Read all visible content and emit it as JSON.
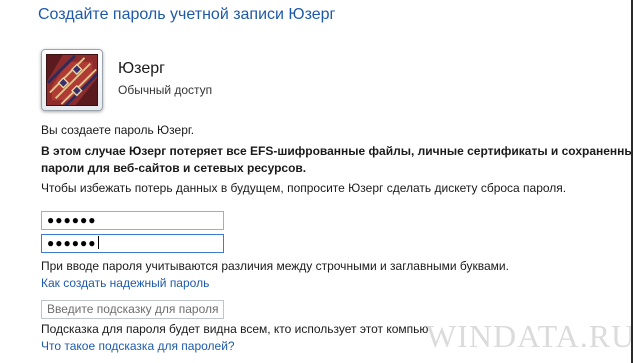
{
  "page": {
    "title": "Создайте пароль учетной записи Юзерг"
  },
  "account": {
    "name": "Юзерг",
    "type": "Обычный доступ",
    "avatar_icon": "user-picture-carpet-icon"
  },
  "messages": {
    "creating": "Вы создаете пароль Юзерг.",
    "warning_line1": "В этом случае Юзерг потеряет все EFS-шифрованные файлы, личные сертификаты и сохраненные",
    "warning_line2": "пароли для веб-сайтов и сетевых ресурсов.",
    "advice": "Чтобы избежать потерь данных в будущем, попросите Юзерг сделать дискету сброса пароля."
  },
  "form": {
    "password_value": "●●●●●●",
    "confirm_value": "●●●●●●",
    "case_note": "При вводе пароля учитываются различия между строчными и заглавными буквами.",
    "strong_password_link": "Как создать надежный пароль",
    "hint_placeholder": "Введите подсказку для пароля",
    "hint_note": "Подсказка для пароля будет видна всем, кто использует этот компью",
    "hint_link": "Что такое подсказка для паролей?"
  },
  "watermark": {
    "text": "WINDATA.RU"
  },
  "colors": {
    "title_blue": "#1e5aa8",
    "link_blue": "#1e5aa8",
    "focus_border": "#3d7bd6"
  }
}
